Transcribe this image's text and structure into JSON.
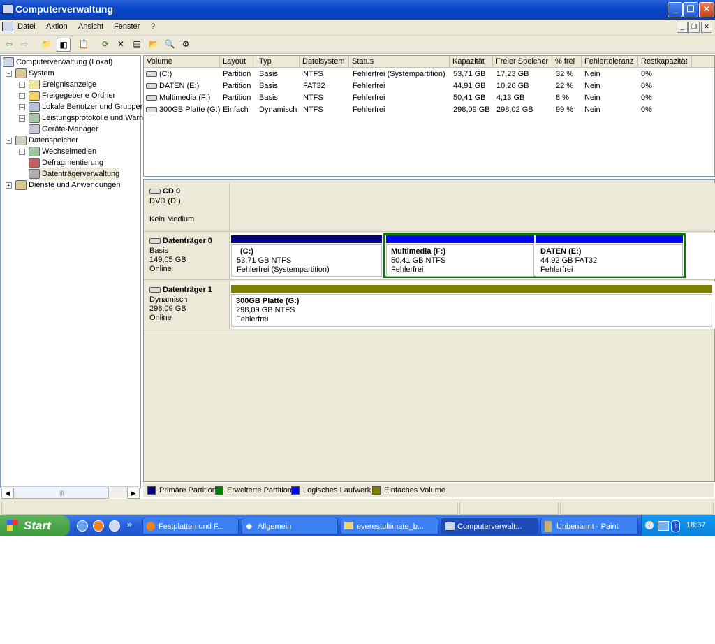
{
  "window": {
    "title": "Computerverwaltung"
  },
  "menu": {
    "items": [
      "Datei",
      "Aktion",
      "Ansicht",
      "Fenster",
      "?"
    ]
  },
  "tree": {
    "root": "Computerverwaltung (Lokal)",
    "system": "System",
    "ereignisanzeige": "Ereignisanzeige",
    "freigegebene": "Freigegebene Ordner",
    "benutzer": "Lokale Benutzer und Gruppen",
    "leistung": "Leistungsprotokolle und Warn",
    "geraete": "Geräte-Manager",
    "datenspeicher": "Datenspeicher",
    "wechsel": "Wechselmedien",
    "defrag": "Defragmentierung",
    "dtverwaltung": "Datenträgerverwaltung",
    "dienste": "Dienste und Anwendungen"
  },
  "table": {
    "columns": [
      "Volume",
      "Layout",
      "Typ",
      "Dateisystem",
      "Status",
      "Kapazität",
      "Freier Speicher",
      "% frei",
      "Fehlertoleranz",
      "Restkapazität"
    ],
    "rows": [
      [
        "(C:)",
        "Partition",
        "Basis",
        "NTFS",
        "Fehlerfrei (Systempartition)",
        "53,71 GB",
        "17,23 GB",
        "32 %",
        "Nein",
        "0%"
      ],
      [
        "DATEN (E:)",
        "Partition",
        "Basis",
        "FAT32",
        "Fehlerfrei",
        "44,91 GB",
        "10,26 GB",
        "22 %",
        "Nein",
        "0%"
      ],
      [
        "Multimedia (F:)",
        "Partition",
        "Basis",
        "NTFS",
        "Fehlerfrei",
        "50,41 GB",
        "4,13 GB",
        "8 %",
        "Nein",
        "0%"
      ],
      [
        "300GB Platte (G:)",
        "Einfach",
        "Dynamisch",
        "NTFS",
        "Fehlerfrei",
        "298,09 GB",
        "298,02 GB",
        "99 %",
        "Nein",
        "0%"
      ]
    ]
  },
  "disks": {
    "cd0": {
      "name": "CD 0",
      "type": "DVD (D:)",
      "status": "Kein Medium"
    },
    "d0": {
      "name": "Datenträger 0",
      "type": "Basis",
      "size": "149,05 GB",
      "state": "Online",
      "p1": {
        "title": "(C:)",
        "size": "53,71 GB NTFS",
        "status": "Fehlerfrei (Systempartition)"
      },
      "p2": {
        "title": "Multimedia  (F:)",
        "size": "50,41 GB NTFS",
        "status": "Fehlerfrei"
      },
      "p3": {
        "title": "DATEN  (E:)",
        "size": "44,92 GB FAT32",
        "status": "Fehlerfrei"
      }
    },
    "d1": {
      "name": "Datenträger 1",
      "type": "Dynamisch",
      "size": "298,09 GB",
      "state": "Online",
      "p1": {
        "title": "300GB Platte  (G:)",
        "size": "298,09 GB NTFS",
        "status": "Fehlerfrei"
      }
    }
  },
  "legend": {
    "primary": "Primäre Partition",
    "extended": "Erweiterte Partition",
    "logical": "Logisches Laufwerk",
    "simple": "Einfaches Volume"
  },
  "colors": {
    "primary": "#000080",
    "extended": "#008000",
    "logical": "#0000ff",
    "simple": "#808000"
  },
  "taskbar": {
    "start": "Start",
    "tasks": [
      "Festplatten und F...",
      "Allgemein",
      "everestultimate_b...",
      "Computerverwalt...",
      "Unbenannt - Paint"
    ],
    "clock": "18:37"
  }
}
